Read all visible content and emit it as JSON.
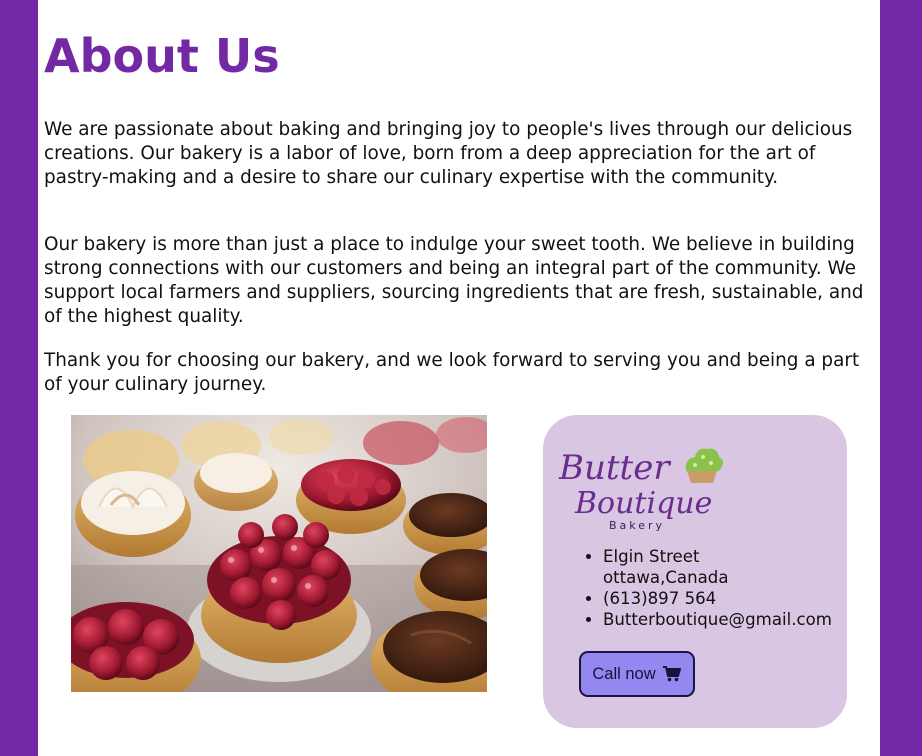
{
  "page": {
    "title": "About Us",
    "paragraphs": [
      "We are passionate about baking and bringing joy to people's lives through our delicious creations. Our bakery is a labor of love, born from a deep appreciation for the art of pastry-making and a desire to share our culinary expertise with the community.",
      "Our bakery is more than just a place to indulge your sweet tooth. We believe in building strong connections with our customers and being an integral part of the community. We support local farmers and suppliers, sourcing ingredients that are fresh, sustainable, and of the highest quality.",
      "Thank you for choosing our bakery, and we look forward to serving you and being a part of your culinary journey."
    ]
  },
  "contact": {
    "logo": {
      "line1": "Butter",
      "line2": "Boutique",
      "line3": "Bakery"
    },
    "address_line1": "Elgin Street",
    "address_line2": "ottawa,Canada",
    "phone": "(613)897 564",
    "email": "Butterboutique@gmail.com",
    "call_label": "Call now",
    "call_icon": "cart-icon"
  },
  "colors": {
    "brand_purple": "#7228a3",
    "card_bg": "#d8c6e2",
    "button_bg": "#9288ef"
  }
}
